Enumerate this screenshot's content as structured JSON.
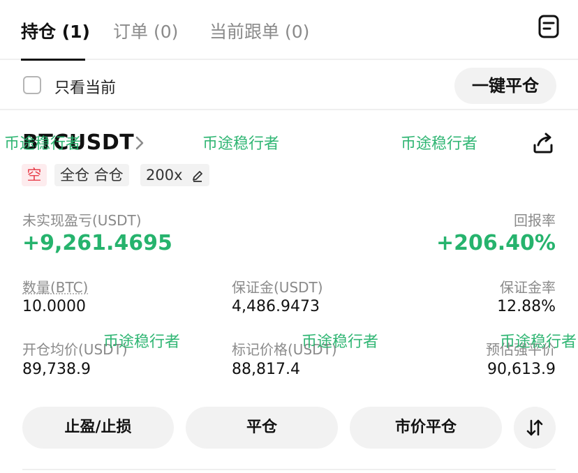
{
  "tabs": [
    {
      "label": "持仓 (1)"
    },
    {
      "label": "订单 (0)"
    },
    {
      "label": "当前跟单 (0)"
    }
  ],
  "filter": {
    "only_current_label": "只看当前",
    "close_all_label": "一键平仓"
  },
  "position": {
    "symbol": "BTCUSDT",
    "side": "空",
    "margin_mode": "全仓 合仓",
    "leverage": "200x",
    "unrealized_pnl_label": "未实现盈亏(USDT)",
    "unrealized_pnl_value": "+9,261.4695",
    "roe_label": "回报率",
    "roe_value": "+206.40%",
    "quantity_label": "数量(BTC)",
    "quantity_value": "10.0000",
    "margin_label": "保证金(USDT)",
    "margin_value": "4,486.9473",
    "margin_ratio_label": "保证金率",
    "margin_ratio_value": "12.88%",
    "entry_price_label": "开仓均价(USDT)",
    "entry_price_value": "89,738.9",
    "mark_price_label": "标记价格(USDT)",
    "mark_price_value": "88,817.4",
    "liq_price_label": "预估强平价",
    "liq_price_value": "90,613.9"
  },
  "actions": {
    "tpsl_label": "止盈/止损",
    "close_label": "平仓",
    "market_close_label": "市价平仓"
  },
  "watermark": "币途稳行者",
  "icons": {
    "orders": "document-list-icon",
    "share": "share-icon",
    "chevron": "chevron-right-icon",
    "edit": "pencil-icon",
    "swap": "swap-arrows-icon"
  },
  "colors": {
    "profit_green": "#26b36d",
    "short_red": "#e8424e",
    "button_bg": "#f2f2f2"
  }
}
